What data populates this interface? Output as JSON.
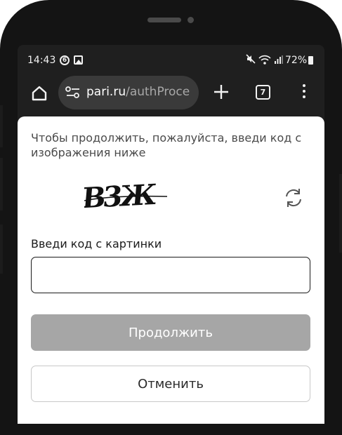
{
  "status_bar": {
    "time": "14:43",
    "notification_badge": "6",
    "battery_percent": "72%"
  },
  "browser": {
    "url_domain": "pari.ru",
    "url_path": "/authProce",
    "tab_count": "7"
  },
  "captcha_dialog": {
    "instruction": "Чтобы продолжить, пожалуйста, введи код с изображения ниже",
    "captcha_text": "B3Ж",
    "input_label": "Введи код с картинки",
    "input_value": "",
    "input_placeholder": "",
    "continue_label": "Продолжить",
    "cancel_label": "Отменить"
  },
  "colors": {
    "frame": "#141414",
    "screen_bg": "#1f1f1f",
    "url_bar_bg": "#3a3a3a",
    "continue_button_bg": "#a6a6a6",
    "sheet_bg": "#ffffff"
  }
}
